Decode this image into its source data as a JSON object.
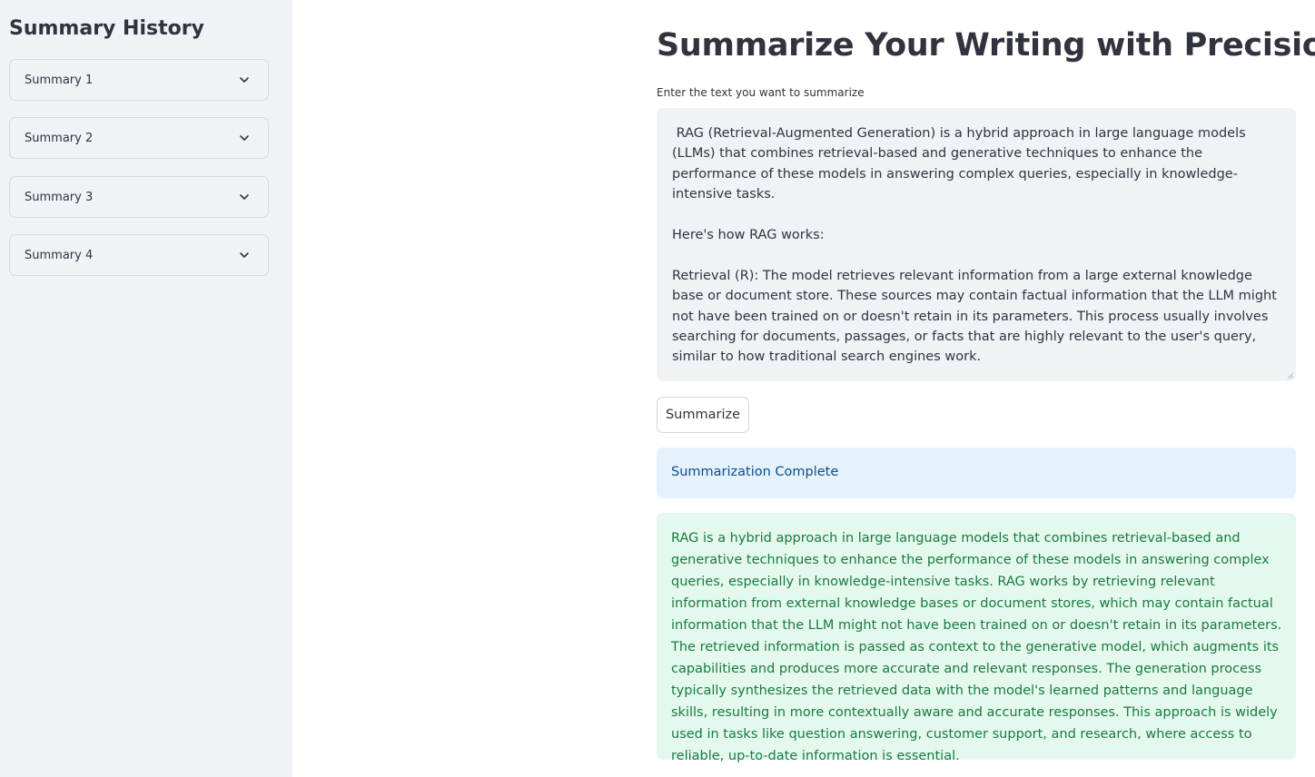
{
  "sidebar": {
    "title": "Summary History",
    "items": [
      {
        "label": "Summary 1"
      },
      {
        "label": "Summary 2"
      },
      {
        "label": "Summary 3"
      },
      {
        "label": "Summary 4"
      }
    ]
  },
  "main": {
    "title": "Summarize Your Writing with Precision!",
    "input_label": "Enter the text you want to summarize",
    "input_value": " RAG (Retrieval-Augmented Generation) is a hybrid approach in large language models (LLMs) that combines retrieval-based and generative techniques to enhance the performance of these models in answering complex queries, especially in knowledge-intensive tasks.\n\nHere's how RAG works:\n\nRetrieval (R): The model retrieves relevant information from a large external knowledge base or document store. These sources may contain factual information that the LLM might not have been trained on or doesn't retain in its parameters. This process usually involves searching for documents, passages, or facts that are highly relevant to the user's query, similar to how traditional search engines work.\n\nAugmentation (A): The retrieved information is passed as context to the generative model.",
    "button_label": "Summarize",
    "info_message": "Summarization Complete",
    "summary_output": "RAG is a hybrid approach in large language models that combines retrieval-based and generative techniques to enhance the performance of these models in answering complex queries, especially in knowledge-intensive tasks. RAG works by retrieving relevant information from external knowledge bases or document stores, which may contain factual information that the LLM might not have been trained on or doesn't retain in its parameters. The retrieved information is passed as context to the generative model, which augments its capabilities and produces more accurate and relevant responses. The generation process typically synthesizes the retrieved data with the model's learned patterns and language skills, resulting in more contextually aware and accurate responses. This approach is widely used in tasks like question answering, customer support, and research, where access to reliable, up-to-date information is essential."
  },
  "icons": {
    "expander": "chevron-down-icon",
    "textarea": "resize-handle-icon"
  },
  "colors": {
    "sidebar_bg": "#f0f2f6",
    "info_bg": "#e5f2fc",
    "info_text": "#0b4d8e",
    "success_bg": "#e5f8ee",
    "success_text": "#187a40"
  }
}
